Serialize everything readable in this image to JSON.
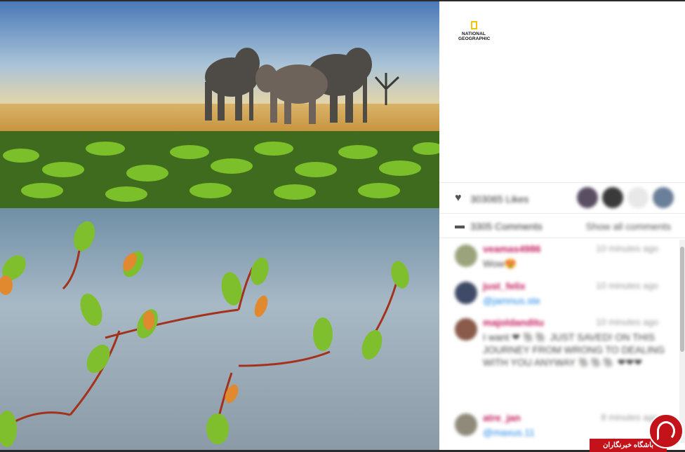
{
  "post": {
    "photo_alt": "elephants",
    "brand_lines": [
      "NATIONAL",
      "GEOGRAPHIC"
    ],
    "likes_text": "303065 Likes",
    "comments_text": "3305 Comments",
    "show_all": "Show all comments"
  },
  "comments": [
    {
      "user": "veamas4986",
      "time": "10 minutes ago",
      "text": "Wow😍",
      "mention": ""
    },
    {
      "user": "just_felix",
      "time": "10 minutes ago",
      "text": "",
      "mention": "@jamnus.ste"
    },
    {
      "user": "majoldanditu",
      "time": "10 minutes ago",
      "text": "I want ❤ 🐘🐘 JUST SAVED! ON THIS JOURNEY FROM WRONG TO DEALING WITH YOU ANYWAY 🐘🐘🐘 ❤❤❤",
      "mention": ""
    },
    {
      "user": "atre_jan",
      "time": "8 minutes ago",
      "text": "",
      "mention": "@maxus.11"
    }
  ],
  "watermark": {
    "text": "باشگاه خبرنگاران"
  },
  "colors": {
    "accent": "#c2185b",
    "link": "#1e88e5",
    "brand_red": "#c4121a",
    "logo_yellow": "#f5c400"
  },
  "icons": {
    "likes": "heart-icon",
    "comments": "comment-icon"
  }
}
